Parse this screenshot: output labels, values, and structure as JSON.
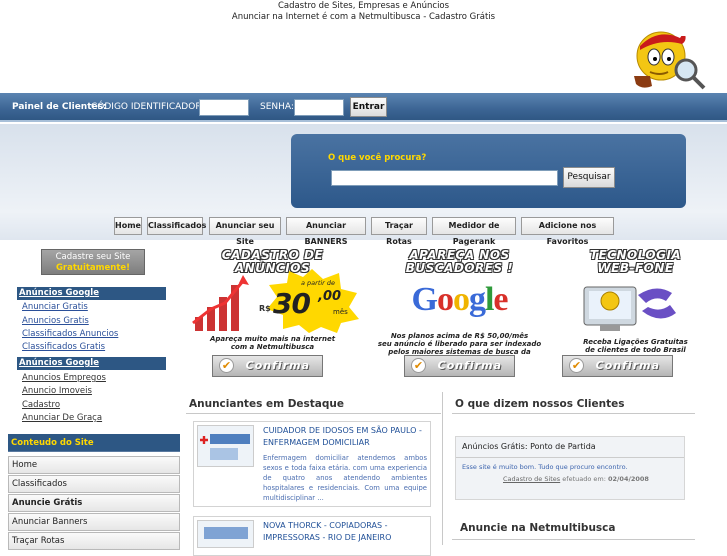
{
  "header": {
    "title": "Cadastro de Sites, Empresas e Anúncios",
    "subtitle": "Anunciar na Internet é com a Netmultibusca - Cadastro Grátis"
  },
  "login": {
    "panel_label": "Painel de Clientes:",
    "code_label": "CÓDIGO IDENTIFICADOR:",
    "password_label": "SENHA:",
    "submit_label": "Entrar"
  },
  "search": {
    "question": "O que você procura?",
    "button_label": "Pesquisar"
  },
  "nav": {
    "items": [
      "Home",
      "Classificados",
      "Anunciar seu Site",
      "Anunciar BANNERS",
      "Traçar Rotas",
      "Medidor de Pagerank",
      "Adicione nos Favoritos"
    ]
  },
  "sidebar": {
    "cadastre_line1": "Cadastre seu Site",
    "cadastre_line2": "Gratuitamente!",
    "google_header_1": "Anúncios Google",
    "google_links_1": [
      "Anunciar Gratis",
      "Anuncios Gratis",
      "Classificados Anuncios",
      "Classificados Gratis"
    ],
    "google_header_2": "Anúncios Google",
    "google_links_2": [
      "Anuncios Empregos",
      "Anuncio Imoveis",
      "Cadastro",
      "Anunciar De Graça"
    ],
    "content_header": "Conteudo do Site",
    "content_items": [
      "Home",
      "Classificados",
      "Anuncie Grátis",
      "Anunciar Banners",
      "Traçar Rotas"
    ]
  },
  "promos": [
    {
      "title1": "CADASTRO DE",
      "title2": "ANÚNCIOS",
      "price_prefix": "a partir de",
      "price_rs": "R$",
      "price_int": "30",
      "price_dec": ",00",
      "price_suffix": "mês",
      "desc1": "Apareça muito mais na internet",
      "desc2": "com a Netmultibusca",
      "button": "Confirma"
    },
    {
      "title1": "APAREÇA NOS",
      "title2": "BUSCADORES !",
      "logo": "Google",
      "desc1": "Nos planos acima de R$ 50,00/mês",
      "desc2": "seu anúncio é liberado para ser indexado",
      "desc3": "pelos maiores sistemas de busca da internet",
      "button": "Confirma"
    },
    {
      "title1": "TECNOLOGIA",
      "title2": "WEB-FONE",
      "desc1": "Receba Ligações Gratuitas",
      "desc2": "de clientes de todo Brasil",
      "button": "Confirma"
    }
  ],
  "featured": {
    "title": "Anunciantes em Destaque",
    "ads": [
      {
        "title": "CUIDADOR DE IDOSOS EM SÃO PAULO - ENFERMAGEM DOMICILIAR",
        "text": "Enfermagem domiciliar atendemos ambos sexos e toda faixa etária. com uma experiencia de quatro anos atendendo ambientes hospitalares e residenciais. Com uma equipe multidisciplinar ..."
      },
      {
        "title": "NOVA THORCK - COPIADORAS - IMPRESSORAS - RIO DE JANEIRO",
        "text": ""
      }
    ]
  },
  "testimonials": {
    "title": "O que dizem nossos Clientes",
    "card_title": "Anúncios Grátis: Ponto de Partida",
    "quote": "Esse site é muito bom. Tudo que procuro encontro.",
    "source": "Cadastro de Sites",
    "date_label": "efetuado em:",
    "date": "02/04/2008"
  },
  "anuncie": {
    "title": "Anuncie na Netmultibusca"
  },
  "colors": {
    "navy": "#2d5784",
    "yellow": "#ffd800",
    "link": "#2a4f99"
  }
}
